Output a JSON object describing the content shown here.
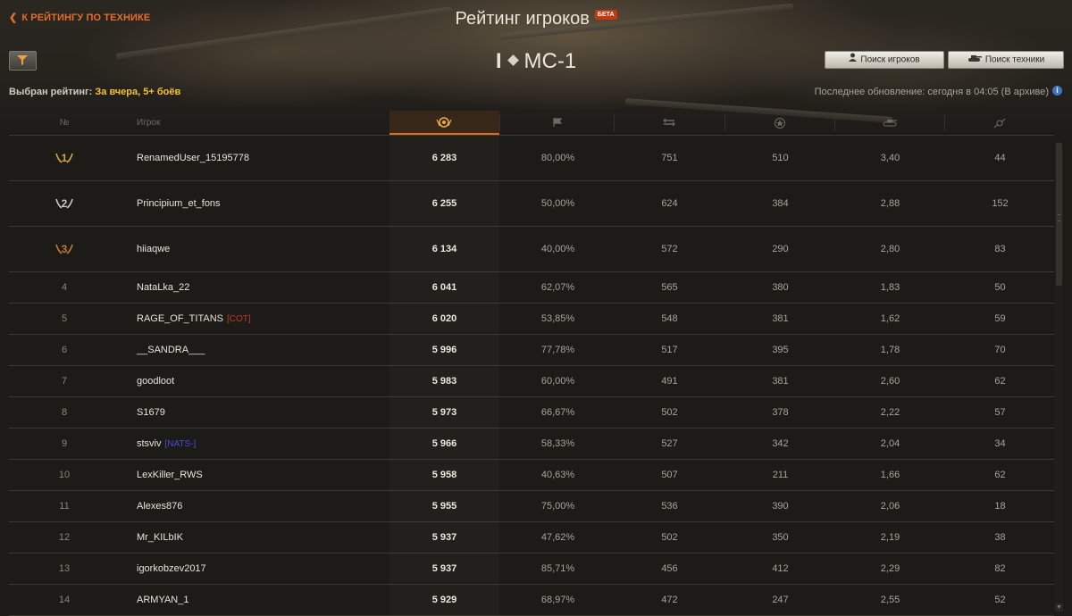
{
  "header": {
    "back_link": "К РЕЙТИНГУ ПО ТЕХНИКЕ",
    "title": "Рейтинг игроков",
    "beta_badge": "БЕТА",
    "vehicle_tier": "I",
    "vehicle_name": "МС-1"
  },
  "toolbar": {
    "filter_icon": "filter-icon",
    "rating_label": "Выбран рейтинг:",
    "rating_value": "За вчера, 5+ боёв",
    "search_players": "Поиск игроков",
    "search_vehicles": "Поиск техники",
    "update_text": "Последнее обновление: сегодня в 04:05 (В архиве)",
    "info_icon": "i"
  },
  "table": {
    "col_rank": "№",
    "col_player": "Игрок",
    "column_icons": [
      "rating-medal-icon",
      "winrate-flag-icon",
      "battles-icon",
      "damage-star-icon",
      "frags-tank-icon",
      "spotted-eye-icon"
    ],
    "rows": [
      {
        "rank": "1",
        "name": "RenamedUser_15195778",
        "clan": "",
        "score": "6 283",
        "wr": "80,00%",
        "battles": "751",
        "damage": "510",
        "frags": "3,40",
        "spot": "44"
      },
      {
        "rank": "2",
        "name": "Principium_et_fons",
        "clan": "",
        "score": "6 255",
        "wr": "50,00%",
        "battles": "624",
        "damage": "384",
        "frags": "2,88",
        "spot": "152"
      },
      {
        "rank": "3",
        "name": "hiiaqwe",
        "clan": "",
        "score": "6 134",
        "wr": "40,00%",
        "battles": "572",
        "damage": "290",
        "frags": "2,80",
        "spot": "83"
      },
      {
        "rank": "4",
        "name": "NataLka_22",
        "clan": "",
        "score": "6 041",
        "wr": "62,07%",
        "battles": "565",
        "damage": "380",
        "frags": "1,83",
        "spot": "50"
      },
      {
        "rank": "5",
        "name": "RAGE_OF_TITANS",
        "clan": "[COT]",
        "score": "6 020",
        "wr": "53,85%",
        "battles": "548",
        "damage": "381",
        "frags": "1,62",
        "spot": "59"
      },
      {
        "rank": "6",
        "name": "__SANDRA___",
        "clan": "",
        "score": "5 996",
        "wr": "77,78%",
        "battles": "517",
        "damage": "395",
        "frags": "1,78",
        "spot": "70"
      },
      {
        "rank": "7",
        "name": "goodloot",
        "clan": "",
        "score": "5 983",
        "wr": "60,00%",
        "battles": "491",
        "damage": "381",
        "frags": "2,60",
        "spot": "62"
      },
      {
        "rank": "8",
        "name": "S1679",
        "clan": "",
        "score": "5 973",
        "wr": "66,67%",
        "battles": "502",
        "damage": "378",
        "frags": "2,22",
        "spot": "57"
      },
      {
        "rank": "9",
        "name": "stsviv",
        "clan": "[NATS-]",
        "score": "5 966",
        "wr": "58,33%",
        "battles": "527",
        "damage": "342",
        "frags": "2,04",
        "spot": "34"
      },
      {
        "rank": "10",
        "name": "LexKiller_RWS",
        "clan": "",
        "score": "5 958",
        "wr": "40,63%",
        "battles": "507",
        "damage": "211",
        "frags": "1,66",
        "spot": "62"
      },
      {
        "rank": "11",
        "name": "Alexes876",
        "clan": "",
        "score": "5 955",
        "wr": "75,00%",
        "battles": "536",
        "damage": "390",
        "frags": "2,06",
        "spot": "18"
      },
      {
        "rank": "12",
        "name": "Mr_KILbIK",
        "clan": "",
        "score": "5 937",
        "wr": "47,62%",
        "battles": "502",
        "damage": "350",
        "frags": "2,19",
        "spot": "38"
      },
      {
        "rank": "13",
        "name": "igorkobzev2017",
        "clan": "",
        "score": "5 937",
        "wr": "85,71%",
        "battles": "456",
        "damage": "412",
        "frags": "2,29",
        "spot": "82"
      },
      {
        "rank": "14",
        "name": "ARMYAN_1",
        "clan": "",
        "score": "5 929",
        "wr": "68,97%",
        "battles": "472",
        "damage": "247",
        "frags": "2,55",
        "spot": "52"
      }
    ]
  },
  "colors": {
    "accent": "#e56d2e",
    "rating_value": "#f4c03a",
    "clan_cot": "#c0392b",
    "clan_nats": "#4a4adb",
    "gold": "#d4a64a",
    "silver": "#c8c8c8",
    "bronze": "#c27a3a"
  }
}
